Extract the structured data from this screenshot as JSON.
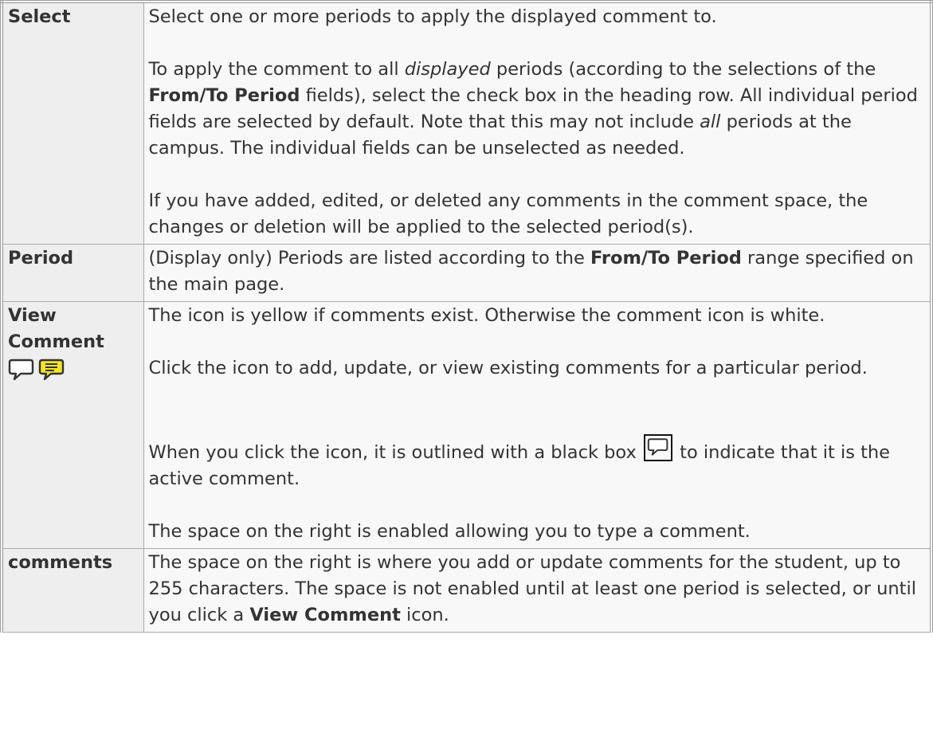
{
  "rows": [
    {
      "term": "Select",
      "p1": "Select one or more periods to apply the displayed comment to.",
      "p2_a": "To apply the comment to all ",
      "p2_b": "displayed",
      "p2_c": " periods (according to the selections of the ",
      "p2_d": "From/To Period",
      "p2_e": " fields), select the check box in the heading row. All individual period fields are selected by default. Note that this may not include ",
      "p2_f": "all",
      "p2_g": " periods at the campus. The individual fields can be unselected as needed.",
      "p3": "If you have added, edited, or deleted any comments in the comment space, the changes or deletion will be applied to the selected period(s)."
    },
    {
      "term": "Period",
      "p1_a": "(Display only) Periods are listed according to the ",
      "p1_b": "From/To Period",
      "p1_c": " range specified on the main page."
    },
    {
      "term": "View Comment",
      "icons": [
        "comment-white-icon",
        "comment-yellow-icon"
      ],
      "p1": "The icon is yellow if comments exist. Otherwise the comment icon is white.",
      "p2": "Click the icon to add, update, or view existing comments for a particular period.",
      "p3_a": "When you click the icon, it is outlined with a black box ",
      "p3_b": " to indicate that it is the active comment.",
      "p4": "The space on the right is enabled allowing you to type a comment."
    },
    {
      "term": "comments",
      "p1_a": "The space on the right is where you add or update comments for the student, up to 255 characters. The space is not enabled until at least one period is selected, or until you click a ",
      "p1_b": "View Comment",
      "p1_c": " icon."
    }
  ],
  "colors": {
    "border": "#aaaaaa",
    "term_bg": "#eeeeee",
    "desc_bg": "#f8f8f8",
    "icon_yellow": "#f5e622",
    "icon_outline": "#333333"
  }
}
